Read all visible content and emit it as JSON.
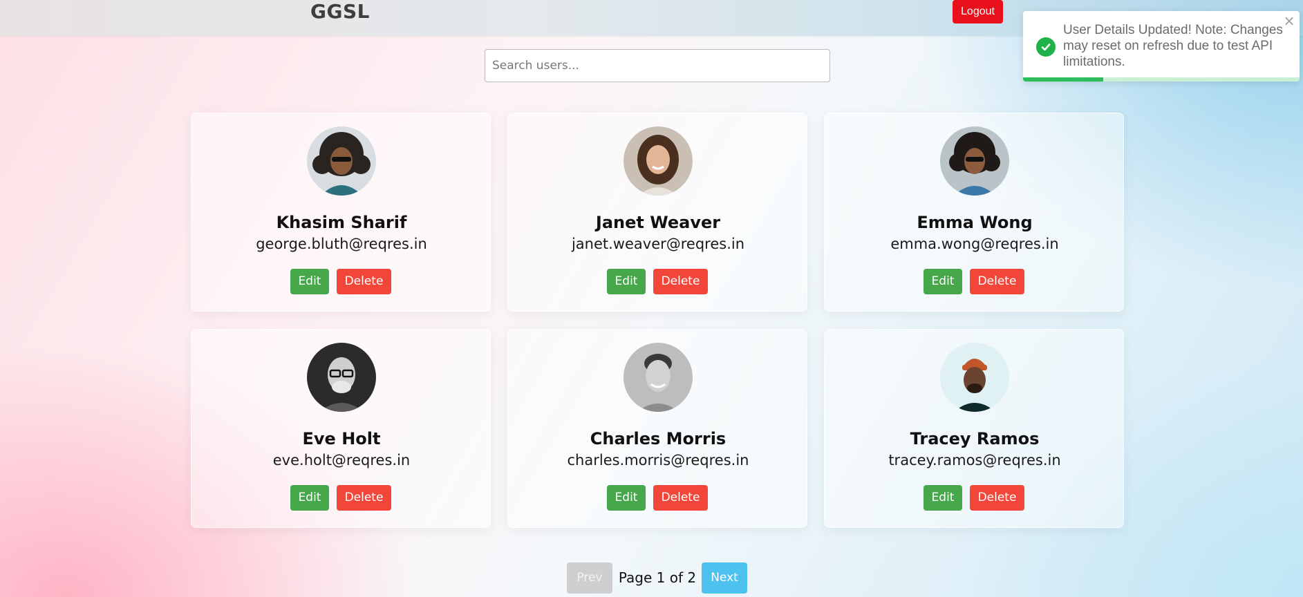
{
  "header": {
    "brand": "GGSL",
    "logout_label": "Logout"
  },
  "search": {
    "placeholder": "Search users...",
    "value": ""
  },
  "toast": {
    "message": "User Details Updated! Note: Changes may reset on refresh due to test API limitations.",
    "icon": "check-circle-icon",
    "close_icon": "close-icon",
    "progress_fraction": 0.29
  },
  "users": [
    {
      "name": "Khasim Sharif",
      "email": "george.bluth@reqres.in",
      "edit_label": "Edit",
      "delete_label": "Delete"
    },
    {
      "name": "Janet Weaver",
      "email": "janet.weaver@reqres.in",
      "edit_label": "Edit",
      "delete_label": "Delete"
    },
    {
      "name": "Emma Wong",
      "email": "emma.wong@reqres.in",
      "edit_label": "Edit",
      "delete_label": "Delete"
    },
    {
      "name": "Eve Holt",
      "email": "eve.holt@reqres.in",
      "edit_label": "Edit",
      "delete_label": "Delete"
    },
    {
      "name": "Charles Morris",
      "email": "charles.morris@reqres.in",
      "edit_label": "Edit",
      "delete_label": "Delete"
    },
    {
      "name": "Tracey Ramos",
      "email": "tracey.ramos@reqres.in",
      "edit_label": "Edit",
      "delete_label": "Delete"
    }
  ],
  "pagination": {
    "prev_label": "Prev",
    "next_label": "Next",
    "page_label": "Page 1 of 2"
  },
  "colors": {
    "logout": "#e8101b",
    "edit": "#46a84a",
    "delete": "#f2463a",
    "next": "#4ec2ef",
    "prev_disabled": "#cfcfcf",
    "success": "#1fb14a"
  }
}
